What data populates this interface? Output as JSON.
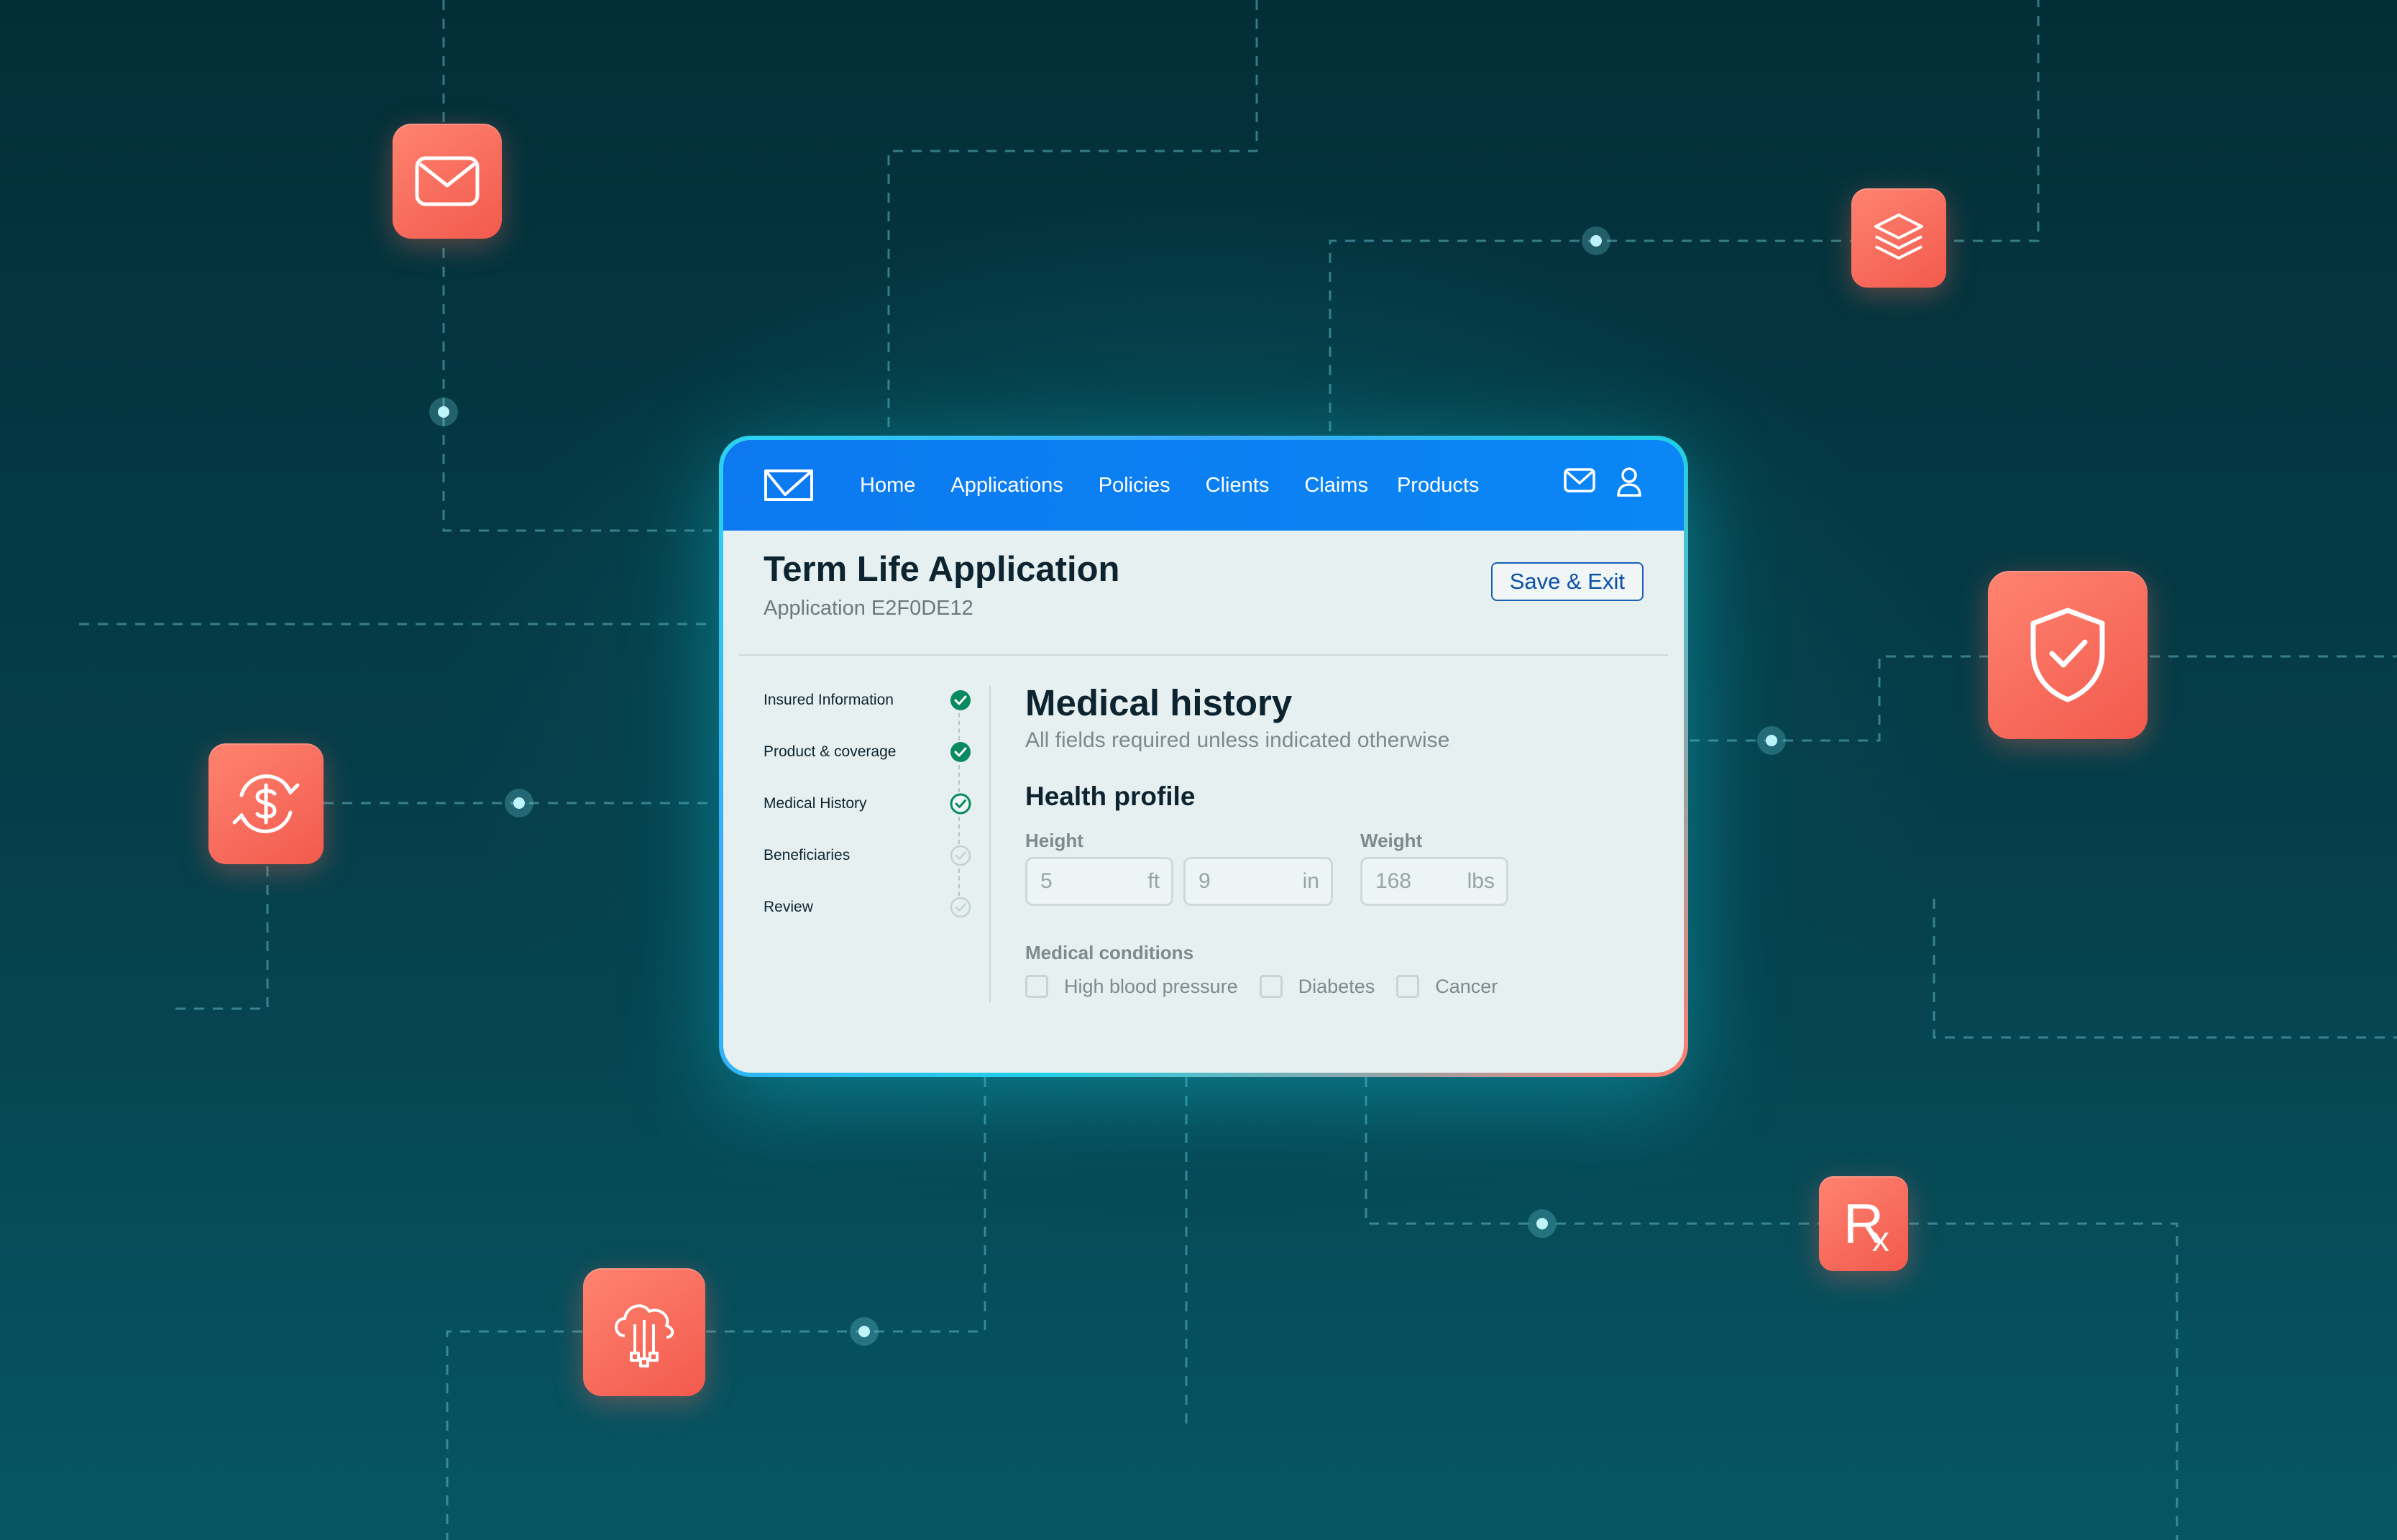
{
  "nav": {
    "links": [
      "Home",
      "Applications",
      "Policies",
      "Clients",
      "Claims",
      "Products"
    ],
    "icons": [
      "mail-icon",
      "user-icon"
    ]
  },
  "application": {
    "title": "Term Life Application",
    "id_label": "Application E2F0DE12",
    "save_label": "Save & Exit"
  },
  "steps": [
    {
      "label": "Insured Information",
      "status": "complete"
    },
    {
      "label": "Product & coverage",
      "status": "complete"
    },
    {
      "label": "Medical History",
      "status": "current"
    },
    {
      "label": "Beneficiaries",
      "status": "pending"
    },
    {
      "label": "Review",
      "status": "pending"
    }
  ],
  "form": {
    "title": "Medical history",
    "subtitle": "All fields required unless indicated otherwise",
    "section": "Health profile",
    "height_label": "Height",
    "weight_label": "Weight",
    "height_ft": {
      "value": "5",
      "unit": "ft"
    },
    "height_in": {
      "value": "9",
      "unit": "in"
    },
    "weight": {
      "value": "168",
      "unit": "lbs"
    },
    "conditions_label": "Medical conditions",
    "conditions": [
      "High blood pressure",
      "Diabetes",
      "Cancer"
    ]
  },
  "floating_icons": [
    "mail-icon",
    "layers-icon",
    "shield-check-icon",
    "dollar-refresh-icon",
    "cloud-network-icon",
    "rx-icon"
  ],
  "floating_rx_text": "R",
  "floating_rx_sub": "x",
  "colors": {
    "nav_blue": "#0c79f0",
    "accent_coral": "#f25a4d",
    "step_complete": "#0a8a5f",
    "background_teal": "#064551"
  }
}
